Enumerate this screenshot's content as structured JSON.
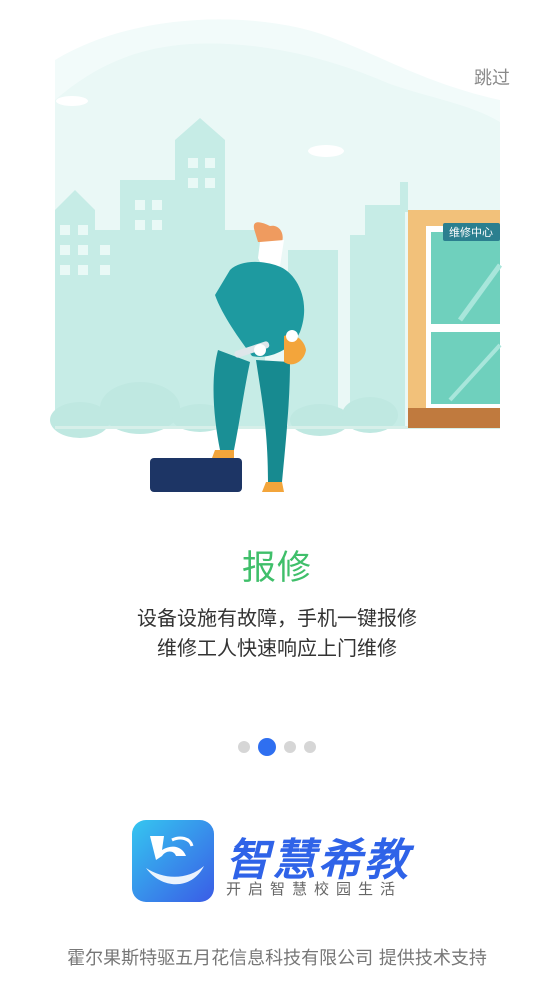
{
  "skip_label": "跳过",
  "illustration": {
    "sign_text": "维修中心"
  },
  "feature": {
    "title": "报修",
    "desc_line1": "设备设施有故障，手机一键报修",
    "desc_line2": "维修工人快速响应上门维修"
  },
  "pagination": {
    "total": 4,
    "active_index": 1
  },
  "brand": {
    "name": "智慧希教",
    "slogan": "开启智慧校园生活"
  },
  "footer": {
    "text": "霍尔果斯特驱五月花信息科技有限公司 提供技术支持"
  },
  "colors": {
    "accent_green": "#3fbf6a",
    "accent_blue": "#2f6ff0",
    "scene_mint": "#dff5f1",
    "worker_teal": "#1e9aa0"
  }
}
